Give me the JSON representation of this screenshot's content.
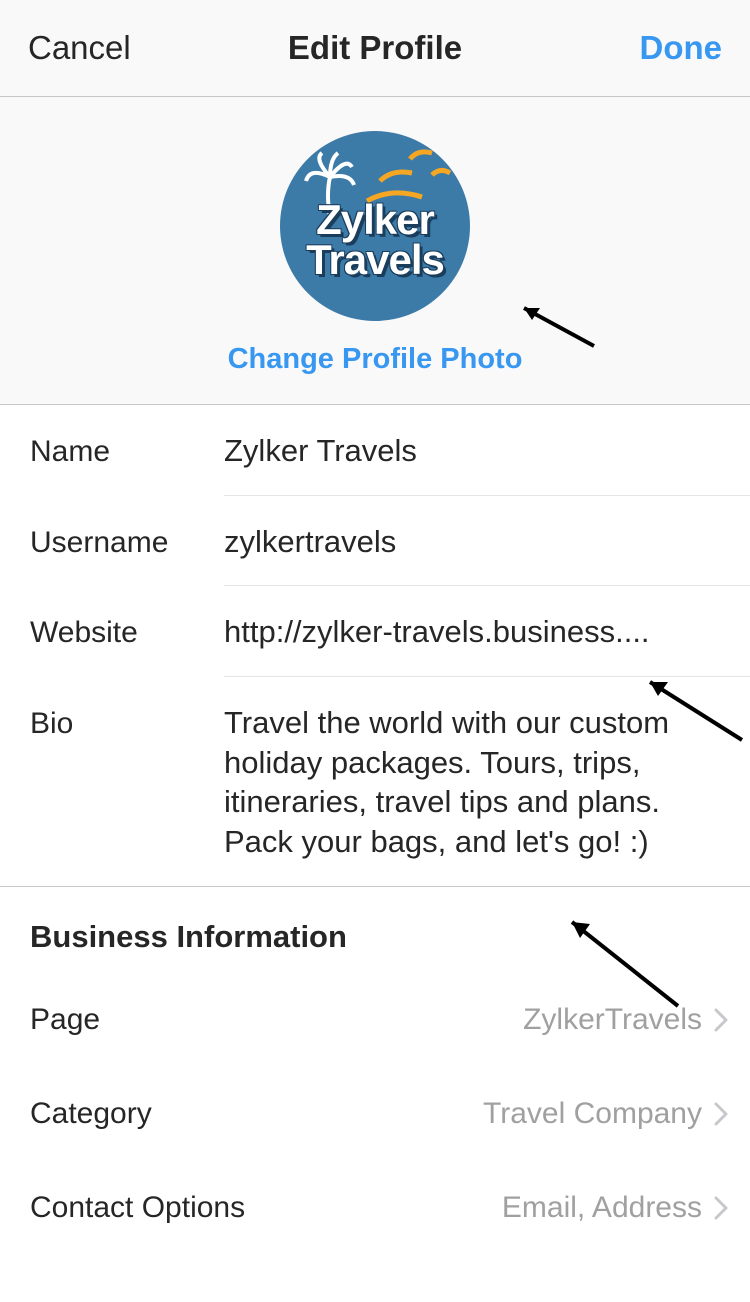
{
  "header": {
    "cancel": "Cancel",
    "title": "Edit Profile",
    "done": "Done"
  },
  "profile_photo": {
    "brand_line1": "Zylker",
    "brand_line2": "Travels",
    "change_label": "Change Profile Photo"
  },
  "form": {
    "name_label": "Name",
    "name_value": "Zylker Travels",
    "username_label": "Username",
    "username_value": "zylkertravels",
    "website_label": "Website",
    "website_value": "http://zylker-travels.business....",
    "bio_label": "Bio",
    "bio_value": "Travel the world with our custom holiday packages. Tours, trips, itineraries, travel tips and plans. Pack your bags, and let's go!  :)"
  },
  "business": {
    "heading": "Business Information",
    "page_label": "Page",
    "page_value": "ZylkerTravels",
    "category_label": "Category",
    "category_value": "Travel Company",
    "contact_label": "Contact Options",
    "contact_value": "Email, Address"
  }
}
